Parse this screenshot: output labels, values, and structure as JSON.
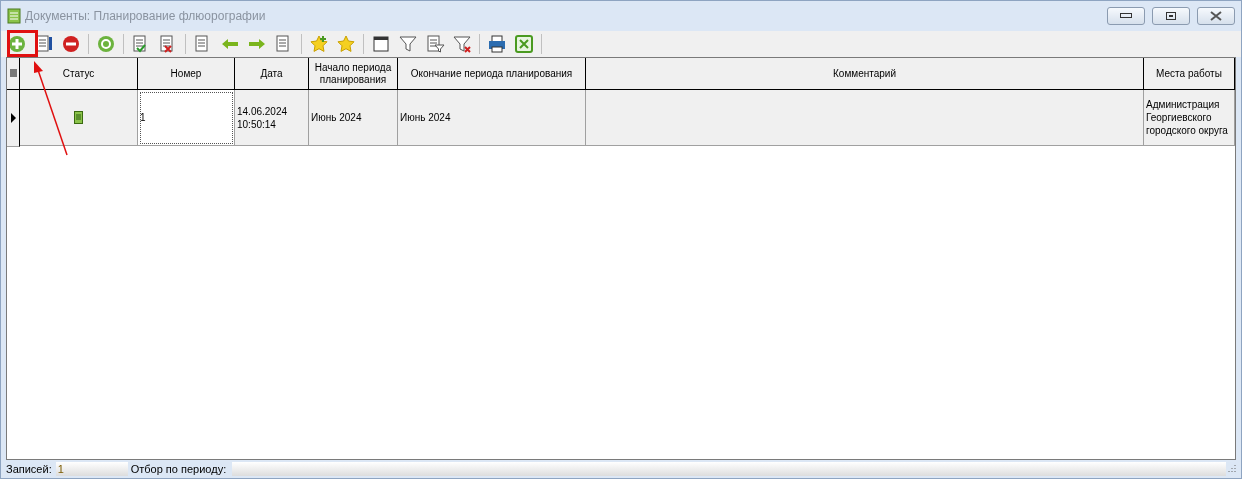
{
  "window": {
    "title": "Документы: Планирование флюорографии"
  },
  "table": {
    "columns": [
      "Статус",
      "Номер",
      "Дата",
      "Начало периода планирования",
      "Окончание периода планирования",
      "Комментарий",
      "Места работы"
    ],
    "rows": [
      {
        "selected": true,
        "cells": [
          {
            "kind": "icon"
          },
          {
            "kind": "text",
            "text": "1",
            "focused": true
          },
          {
            "kind": "text",
            "text": "14.06.2024 10:50:14",
            "focused": false
          },
          {
            "kind": "text",
            "text": "Июнь 2024",
            "focused": false
          },
          {
            "kind": "text",
            "text": "Июнь 2024",
            "focused": false
          },
          {
            "kind": "empty",
            "focused": false
          },
          {
            "kind": "text",
            "text": "Администрация Георгиевского городского округа",
            "focused": false
          }
        ]
      }
    ]
  },
  "status_bar": {
    "records_label": "Записей:",
    "records_value": "1",
    "period_label": "Отбор по периоду:"
  }
}
